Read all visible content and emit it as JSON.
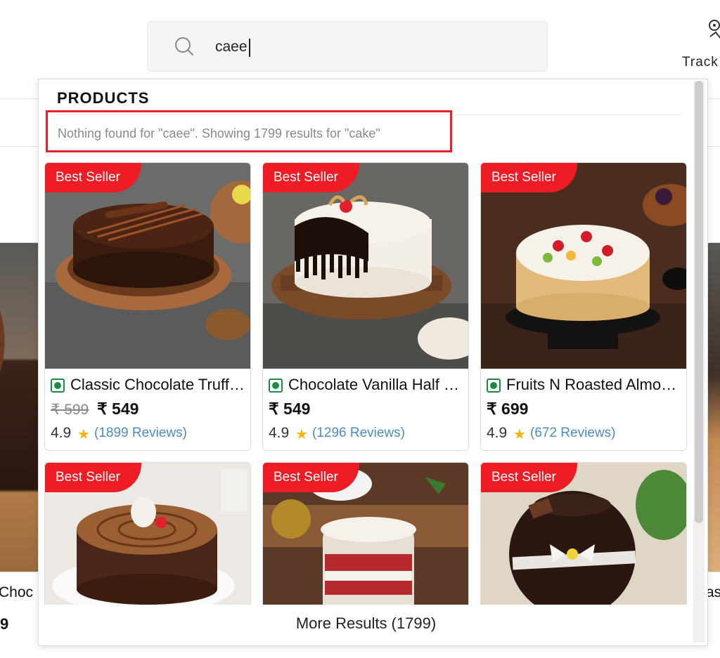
{
  "header": {
    "search": {
      "value": "caee",
      "placeholder": ""
    },
    "track_label": "Track"
  },
  "dropdown": {
    "section_title": "PRODUCTS",
    "notice": "Nothing found for \"caee\". Showing 1799 results for \"cake\"",
    "more_results": "More Results (1799)",
    "products": [
      {
        "badge": "Best Seller",
        "name": "Classic Chocolate Truffle Cake",
        "mrp": "₹ 599",
        "price": "₹ 549",
        "rating": "4.9",
        "reviews": "(1899 Reviews)"
      },
      {
        "badge": "Best Seller",
        "name": "Chocolate Vanilla Half n Half Cake",
        "mrp": "",
        "price": "₹ 549",
        "rating": "4.9",
        "reviews": "(1296 Reviews)"
      },
      {
        "badge": "Best Seller",
        "name": "Fruits N Roasted Almond Cake",
        "mrp": "",
        "price": "₹ 699",
        "rating": "4.9",
        "reviews": "(672 Reviews)"
      },
      {
        "badge": "Best Seller"
      },
      {
        "badge": "Best Seller"
      },
      {
        "badge": "Best Seller"
      }
    ]
  },
  "background": {
    "left_name": "Choc",
    "left_price": "9",
    "right_name": "as"
  },
  "colors": {
    "badge": "#ee1c25",
    "notice_border": "#e8202a",
    "link": "#4a8bc9",
    "veg": "#1e8a45",
    "star": "#f2b50c"
  }
}
